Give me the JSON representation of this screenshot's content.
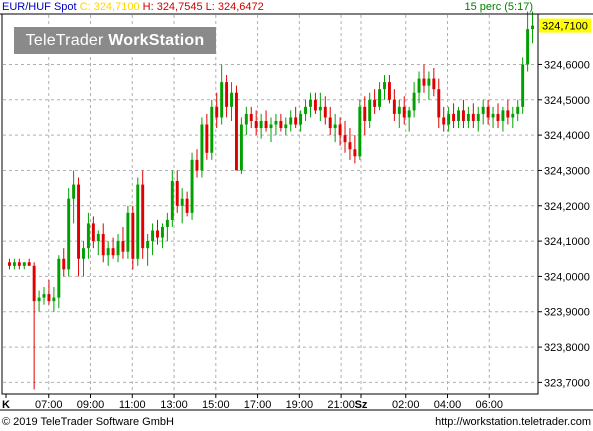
{
  "header": {
    "symbol": "EUR/HUF Spot",
    "close_label": "C: 324,7100",
    "high_label": "H: 324,7545",
    "low_label": "L: 324,6472",
    "interval": "15 perc (5:17)"
  },
  "logo": {
    "part1": "TeleTrader",
    "part2": "WorkStation"
  },
  "footer": {
    "copyright": "© 2019 TeleTrader Software GmbH",
    "url": "http://workstation.teletrader.com"
  },
  "colors": {
    "up": "#00a000",
    "down": "#e00000",
    "grid": "#b0b0b0",
    "last_price_bg": "#ffff00"
  },
  "chart_data": {
    "type": "candlestick",
    "ylim": [
      323.67,
      324.74
    ],
    "yticks": [
      "324,6000",
      "324,5000",
      "324,4000",
      "324,3000",
      "324,2000",
      "324,1000",
      "324,0000",
      "323,9000",
      "323,8000",
      "323,7000"
    ],
    "ytick_values": [
      324.6,
      324.5,
      324.4,
      324.3,
      324.2,
      324.1,
      324.0,
      323.9,
      323.8,
      323.7
    ],
    "last_price": 324.71,
    "last_price_label": "324,7100",
    "xlabels": [
      "K",
      "07:00",
      "09:00",
      "11:00",
      "13:00",
      "15:00",
      "17:00",
      "19:00",
      "21:00",
      "Sz",
      "02:00",
      "04:00",
      "06:00"
    ],
    "candles": [
      {
        "o": 324.04,
        "h": 324.05,
        "l": 324.02,
        "c": 324.03
      },
      {
        "o": 324.03,
        "h": 324.05,
        "l": 324.02,
        "c": 324.04
      },
      {
        "o": 324.04,
        "h": 324.05,
        "l": 324.02,
        "c": 324.03
      },
      {
        "o": 324.03,
        "h": 324.04,
        "l": 324.02,
        "c": 324.04
      },
      {
        "o": 324.04,
        "h": 324.05,
        "l": 324.03,
        "c": 324.03
      },
      {
        "o": 324.03,
        "h": 324.04,
        "l": 323.68,
        "c": 323.93
      },
      {
        "o": 323.93,
        "h": 323.96,
        "l": 323.9,
        "c": 323.94
      },
      {
        "o": 323.94,
        "h": 323.97,
        "l": 323.92,
        "c": 323.95
      },
      {
        "o": 323.95,
        "h": 323.99,
        "l": 323.92,
        "c": 323.93
      },
      {
        "o": 323.93,
        "h": 323.97,
        "l": 323.9,
        "c": 323.94
      },
      {
        "o": 323.94,
        "h": 324.06,
        "l": 323.91,
        "c": 324.05
      },
      {
        "o": 324.05,
        "h": 324.08,
        "l": 324.0,
        "c": 324.02
      },
      {
        "o": 324.02,
        "h": 324.25,
        "l": 324.0,
        "c": 324.22
      },
      {
        "o": 324.22,
        "h": 324.3,
        "l": 324.15,
        "c": 324.26
      },
      {
        "o": 324.26,
        "h": 324.28,
        "l": 324.0,
        "c": 324.05
      },
      {
        "o": 324.05,
        "h": 324.1,
        "l": 324.0,
        "c": 324.08
      },
      {
        "o": 324.08,
        "h": 324.18,
        "l": 324.05,
        "c": 324.15
      },
      {
        "o": 324.15,
        "h": 324.17,
        "l": 324.08,
        "c": 324.1
      },
      {
        "o": 324.1,
        "h": 324.13,
        "l": 324.06,
        "c": 324.12
      },
      {
        "o": 324.12,
        "h": 324.15,
        "l": 324.04,
        "c": 324.06
      },
      {
        "o": 324.06,
        "h": 324.1,
        "l": 324.03,
        "c": 324.08
      },
      {
        "o": 324.08,
        "h": 324.11,
        "l": 324.05,
        "c": 324.06
      },
      {
        "o": 324.06,
        "h": 324.12,
        "l": 324.04,
        "c": 324.1
      },
      {
        "o": 324.1,
        "h": 324.14,
        "l": 324.05,
        "c": 324.07
      },
      {
        "o": 324.07,
        "h": 324.2,
        "l": 324.05,
        "c": 324.18
      },
      {
        "o": 324.18,
        "h": 324.2,
        "l": 324.02,
        "c": 324.05
      },
      {
        "o": 324.05,
        "h": 324.28,
        "l": 324.03,
        "c": 324.26
      },
      {
        "o": 324.26,
        "h": 324.3,
        "l": 324.05,
        "c": 324.08
      },
      {
        "o": 324.08,
        "h": 324.12,
        "l": 324.03,
        "c": 324.1
      },
      {
        "o": 324.1,
        "h": 324.15,
        "l": 324.06,
        "c": 324.13
      },
      {
        "o": 324.13,
        "h": 324.16,
        "l": 324.09,
        "c": 324.11
      },
      {
        "o": 324.11,
        "h": 324.15,
        "l": 324.08,
        "c": 324.14
      },
      {
        "o": 324.14,
        "h": 324.18,
        "l": 324.1,
        "c": 324.16
      },
      {
        "o": 324.16,
        "h": 324.3,
        "l": 324.14,
        "c": 324.27
      },
      {
        "o": 324.27,
        "h": 324.3,
        "l": 324.18,
        "c": 324.2
      },
      {
        "o": 324.2,
        "h": 324.25,
        "l": 324.15,
        "c": 324.22
      },
      {
        "o": 324.22,
        "h": 324.24,
        "l": 324.17,
        "c": 324.18
      },
      {
        "o": 324.18,
        "h": 324.35,
        "l": 324.16,
        "c": 324.33
      },
      {
        "o": 324.33,
        "h": 324.36,
        "l": 324.28,
        "c": 324.3
      },
      {
        "o": 324.3,
        "h": 324.45,
        "l": 324.28,
        "c": 324.43
      },
      {
        "o": 324.43,
        "h": 324.46,
        "l": 324.33,
        "c": 324.35
      },
      {
        "o": 324.35,
        "h": 324.5,
        "l": 324.33,
        "c": 324.48
      },
      {
        "o": 324.48,
        "h": 324.52,
        "l": 324.42,
        "c": 324.45
      },
      {
        "o": 324.45,
        "h": 324.6,
        "l": 324.43,
        "c": 324.55
      },
      {
        "o": 324.55,
        "h": 324.57,
        "l": 324.45,
        "c": 324.48
      },
      {
        "o": 324.48,
        "h": 324.55,
        "l": 324.44,
        "c": 324.52
      },
      {
        "o": 324.52,
        "h": 324.54,
        "l": 324.3,
        "c": 324.3
      },
      {
        "o": 324.3,
        "h": 324.45,
        "l": 324.29,
        "c": 324.43
      },
      {
        "o": 324.43,
        "h": 324.48,
        "l": 324.4,
        "c": 324.46
      },
      {
        "o": 324.46,
        "h": 324.48,
        "l": 324.42,
        "c": 324.44
      },
      {
        "o": 324.44,
        "h": 324.47,
        "l": 324.4,
        "c": 324.42
      },
      {
        "o": 324.42,
        "h": 324.46,
        "l": 324.39,
        "c": 324.44
      },
      {
        "o": 324.44,
        "h": 324.47,
        "l": 324.41,
        "c": 324.42
      },
      {
        "o": 324.42,
        "h": 324.45,
        "l": 324.38,
        "c": 324.43
      },
      {
        "o": 324.43,
        "h": 324.46,
        "l": 324.4,
        "c": 324.44
      },
      {
        "o": 324.44,
        "h": 324.46,
        "l": 324.41,
        "c": 324.42
      },
      {
        "o": 324.42,
        "h": 324.45,
        "l": 324.4,
        "c": 324.43
      },
      {
        "o": 324.43,
        "h": 324.47,
        "l": 324.41,
        "c": 324.45
      },
      {
        "o": 324.45,
        "h": 324.48,
        "l": 324.42,
        "c": 324.43
      },
      {
        "o": 324.43,
        "h": 324.47,
        "l": 324.41,
        "c": 324.46
      },
      {
        "o": 324.46,
        "h": 324.5,
        "l": 324.44,
        "c": 324.48
      },
      {
        "o": 324.48,
        "h": 324.52,
        "l": 324.45,
        "c": 324.5
      },
      {
        "o": 324.5,
        "h": 324.52,
        "l": 324.46,
        "c": 324.47
      },
      {
        "o": 324.47,
        "h": 324.52,
        "l": 324.44,
        "c": 324.48
      },
      {
        "o": 324.48,
        "h": 324.51,
        "l": 324.43,
        "c": 324.45
      },
      {
        "o": 324.45,
        "h": 324.48,
        "l": 324.4,
        "c": 324.42
      },
      {
        "o": 324.42,
        "h": 324.46,
        "l": 324.38,
        "c": 324.43
      },
      {
        "o": 324.43,
        "h": 324.45,
        "l": 324.37,
        "c": 324.4
      },
      {
        "o": 324.4,
        "h": 324.44,
        "l": 324.35,
        "c": 324.38
      },
      {
        "o": 324.38,
        "h": 324.42,
        "l": 324.33,
        "c": 324.36
      },
      {
        "o": 324.36,
        "h": 324.4,
        "l": 324.32,
        "c": 324.34
      },
      {
        "o": 324.34,
        "h": 324.5,
        "l": 324.33,
        "c": 324.48
      },
      {
        "o": 324.48,
        "h": 324.51,
        "l": 324.4,
        "c": 324.44
      },
      {
        "o": 324.44,
        "h": 324.52,
        "l": 324.42,
        "c": 324.5
      },
      {
        "o": 324.5,
        "h": 324.53,
        "l": 324.46,
        "c": 324.48
      },
      {
        "o": 324.48,
        "h": 324.55,
        "l": 324.47,
        "c": 324.53
      },
      {
        "o": 324.53,
        "h": 324.57,
        "l": 324.5,
        "c": 324.55
      },
      {
        "o": 324.55,
        "h": 324.57,
        "l": 324.49,
        "c": 324.5
      },
      {
        "o": 324.5,
        "h": 324.53,
        "l": 324.44,
        "c": 324.46
      },
      {
        "o": 324.46,
        "h": 324.5,
        "l": 324.42,
        "c": 324.48
      },
      {
        "o": 324.48,
        "h": 324.51,
        "l": 324.43,
        "c": 324.45
      },
      {
        "o": 324.45,
        "h": 324.48,
        "l": 324.41,
        "c": 324.47
      },
      {
        "o": 324.47,
        "h": 324.55,
        "l": 324.45,
        "c": 324.52
      },
      {
        "o": 324.52,
        "h": 324.58,
        "l": 324.49,
        "c": 324.56
      },
      {
        "o": 324.56,
        "h": 324.6,
        "l": 324.52,
        "c": 324.54
      },
      {
        "o": 324.54,
        "h": 324.58,
        "l": 324.5,
        "c": 324.56
      },
      {
        "o": 324.56,
        "h": 324.59,
        "l": 324.51,
        "c": 324.53
      },
      {
        "o": 324.53,
        "h": 324.56,
        "l": 324.42,
        "c": 324.45
      },
      {
        "o": 324.45,
        "h": 324.48,
        "l": 324.41,
        "c": 324.43
      },
      {
        "o": 324.43,
        "h": 324.48,
        "l": 324.41,
        "c": 324.46
      },
      {
        "o": 324.46,
        "h": 324.49,
        "l": 324.42,
        "c": 324.44
      },
      {
        "o": 324.44,
        "h": 324.48,
        "l": 324.42,
        "c": 324.47
      },
      {
        "o": 324.47,
        "h": 324.5,
        "l": 324.42,
        "c": 324.44
      },
      {
        "o": 324.44,
        "h": 324.48,
        "l": 324.42,
        "c": 324.46
      },
      {
        "o": 324.46,
        "h": 324.49,
        "l": 324.42,
        "c": 324.44
      },
      {
        "o": 324.44,
        "h": 324.48,
        "l": 324.41,
        "c": 324.46
      },
      {
        "o": 324.46,
        "h": 324.5,
        "l": 324.43,
        "c": 324.48
      },
      {
        "o": 324.48,
        "h": 324.5,
        "l": 324.43,
        "c": 324.45
      },
      {
        "o": 324.45,
        "h": 324.48,
        "l": 324.42,
        "c": 324.46
      },
      {
        "o": 324.46,
        "h": 324.49,
        "l": 324.42,
        "c": 324.44
      },
      {
        "o": 324.44,
        "h": 324.48,
        "l": 324.41,
        "c": 324.47
      },
      {
        "o": 324.47,
        "h": 324.5,
        "l": 324.43,
        "c": 324.45
      },
      {
        "o": 324.45,
        "h": 324.48,
        "l": 324.42,
        "c": 324.46
      },
      {
        "o": 324.46,
        "h": 324.5,
        "l": 324.44,
        "c": 324.48
      },
      {
        "o": 324.48,
        "h": 324.62,
        "l": 324.46,
        "c": 324.6
      },
      {
        "o": 324.6,
        "h": 324.75,
        "l": 324.58,
        "c": 324.7
      },
      {
        "o": 324.7,
        "h": 324.75,
        "l": 324.66,
        "c": 324.71
      }
    ]
  }
}
